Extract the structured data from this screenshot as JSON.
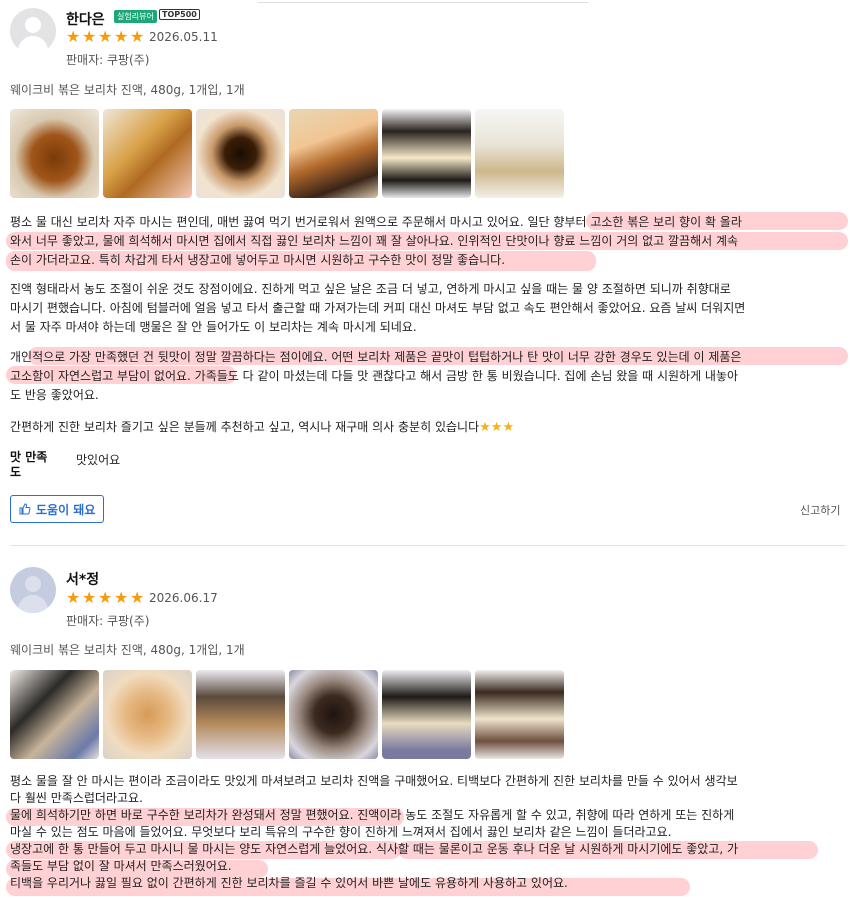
{
  "review1": {
    "name": "한다은",
    "badge_green": "실험리뷰어",
    "badge_top": "TOP500",
    "rating": 5,
    "date": "2026.05.11",
    "seller": "판매자: 쿠팡(주)",
    "product": "웨이크비 볶은 보리차 진액, 480g, 1개입, 1개",
    "paragraphs": [
      [
        "평소 물 대신 보리차 자주 마시는 편인데, 매번 끓여 먹기 번거로워서 원액으로 주문해서 마시고 있어요. 일단 향부터 고소한 볶은 보리 향이 확 올라",
        "와서 너무 좋았고, 물에 희석해서 마시면 집에서 직접 끓인 보리차 느낌이 꽤 잘 살아나요. 인위적인 단맛이나 향료 느낌이 거의 없고 깔끔해서 계속",
        "손이 가더라고요. 특히 차갑게 타서 냉장고에 넣어두고 마시면 시원하고 구수한 맛이 정말 좋습니다."
      ],
      [
        "진액 형태라서 농도 조절이 쉬운 것도 장점이에요. 진하게 먹고 싶은 날은 조금 더 넣고, 연하게 마시고 싶을 때는 물 양 조절하면 되니까 취향대로",
        "마시기 편했습니다. 아침에 텀블러에 얼음 넣고 타서 출근할 때 가져가는데 커피 대신 마셔도 부담 없고 속도 편안해서 좋았어요. 요즘 날씨 더워지면",
        "서 물 자주 마셔야 하는데 맹물은 잘 안 들어가도 이 보리차는 계속 마시게 되네요."
      ],
      [
        "개인적으로 가장 만족했던 건 뒷맛이 정말 깔끔하다는 점이에요. 어떤 보리차 제품은 끝맛이 텁텁하거나 탄 맛이 너무 강한 경우도 있는데 이 제품은",
        "고소함이 자연스럽고 부담이 없어요. 가족들도 다 같이 마셨는데 다들 맛 괜찮다고 해서 금방 한 통 비웠습니다. 집에 손님 왔을 때 시원하게 내놓아",
        "도 반응 좋았어요."
      ],
      [
        "간편하게 진한 보리차 즐기고 싶은 분들께 추천하고 싶고, 역시나 재구매 의사 충분히 있습니다"
      ]
    ],
    "satisfaction_label": "맛 만족도",
    "satisfaction_value": "맛있어요",
    "helpful_label": "도움이 돼요",
    "report_label": "신고하기"
  },
  "review2": {
    "name": "서*정",
    "rating": 5,
    "date": "2026.06.17",
    "seller": "판매자: 쿠팡(주)",
    "product": "웨이크비 볶은 보리차 진액, 480g, 1개입, 1개",
    "lines": [
      "평소 물을 잘 안 마시는 편이라 조금이라도 맛있게 마셔보려고 보리차 진액을 구매했어요. 티백보다 간편하게 진한 보리차를 만들 수 있어서 생각보",
      "다 훨씬 만족스럽더라고요.",
      "물에 희석하기만 하면 바로 구수한 보리차가 완성돼서 정말 편했어요. 진액이라 농도 조절도 자유롭게 할 수 있고, 취향에 따라 연하게 또는 진하게",
      "마실 수 있는 점도 마음에 들었어요. 무엇보다 보리 특유의 구수한 향이 진하게 느껴져서 집에서 끓인 보리차 같은 느낌이 들더라고요.",
      "냉장고에 한 통 만들어 두고 마시니 물 마시는 양도 자연스럽게 늘었어요. 식사할 때는 물론이고 운동 후나 더운 날 시원하게 마시기에도 좋았고, 가",
      "족들도 부담 없이 잘 마셔서 만족스러웠어요.",
      "티백을 우리거나 끓일 필요 없이 간편하게 진한 보리차를 즐길 수 있어서 바쁜 날에도 유용하게 사용하고 있어요."
    ]
  },
  "colors": {
    "star": "#f39c12",
    "highlight": "#ff96a0",
    "accent": "#2b6fd6",
    "badge": "#1aa77a"
  }
}
